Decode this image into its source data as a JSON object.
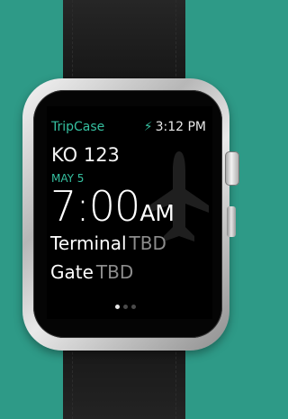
{
  "header": {
    "app_name": "TripCase",
    "time": "3:12 PM",
    "status_icon": "lightning-bolt-icon"
  },
  "flight": {
    "number": "KO 123",
    "date": "MAY 5",
    "departure_time": "7:00",
    "departure_ampm": "AM",
    "terminal_label": "Terminal",
    "terminal_value": "TBD",
    "gate_label": "Gate",
    "gate_value": "TBD"
  },
  "pager": {
    "pages": 3,
    "current": 1
  },
  "colors": {
    "background": "#2e9a87",
    "accent": "#35c0a0",
    "muted": "#8c8c8c"
  }
}
